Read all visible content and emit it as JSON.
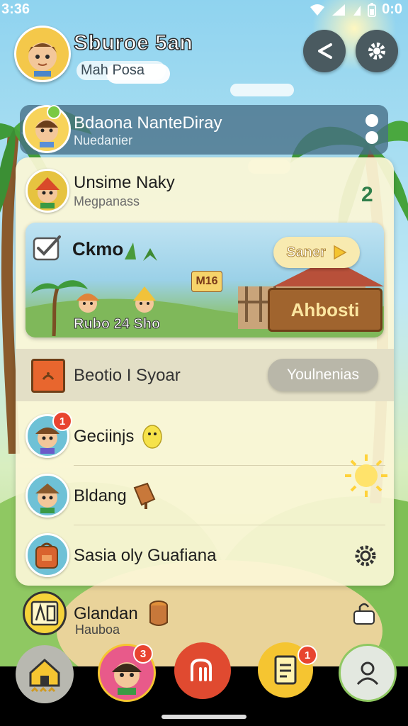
{
  "status": {
    "time": "3:36",
    "right_text": "0:0"
  },
  "header": {
    "title": "Sburoe 5an",
    "subtitle": "Mah Posa"
  },
  "top_row": {
    "name": "Bdaona NanteDiray",
    "detail": "Nuedanier"
  },
  "list": {
    "first": {
      "name": "Unsime Naky",
      "detail": "Megpanass",
      "count": "2"
    },
    "feature": {
      "label": "Ckmo",
      "tag": "M16",
      "button": "Saner",
      "sign": "Ahbosti",
      "caption": "Rubo 24 Sho"
    },
    "section": {
      "label": "Beotio I Syoar",
      "button": "Youlnenias"
    },
    "items": [
      {
        "label": "Geciinjs",
        "badge": "1"
      },
      {
        "label": "Bldang"
      },
      {
        "label": "Sasia oly Guafiana"
      }
    ]
  },
  "bottom_item": {
    "label": "Glandan",
    "sub": "Hauboa"
  },
  "nav": {
    "badge_profile": "3",
    "badge_docs": "1"
  },
  "colors": {
    "accent_red": "#e04a30",
    "accent_yellow": "#f5c531",
    "panel": "#fbf6d6",
    "dark_btn": "#4a5a60"
  }
}
